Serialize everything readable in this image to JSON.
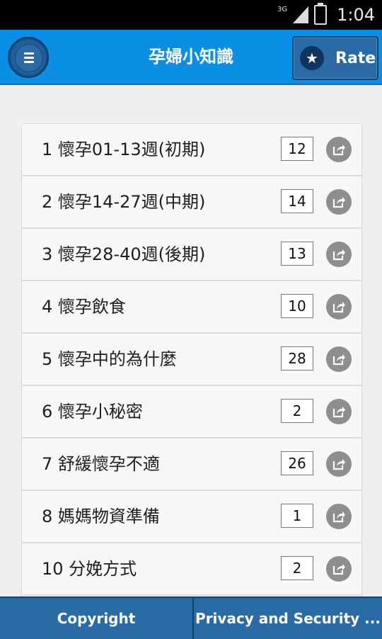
{
  "status_bar": {
    "network": "3G",
    "time": "1:04"
  },
  "app_bar": {
    "menu_icon": "hamburger-menu-icon",
    "title": "孕婦小知識",
    "rate_label": "Rate",
    "rate_icon": "star-icon"
  },
  "list": {
    "items": [
      {
        "label": "1 懷孕01-13週(初期)",
        "count": "12"
      },
      {
        "label": "2 懷孕14-27週(中期)",
        "count": "14"
      },
      {
        "label": "3 懷孕28-40週(後期)",
        "count": "13"
      },
      {
        "label": "4 懷孕飲食",
        "count": "10"
      },
      {
        "label": "5 懷孕中的為什麼",
        "count": "28"
      },
      {
        "label": "6 懷孕小秘密",
        "count": "2"
      },
      {
        "label": "7 舒緩懷孕不適",
        "count": "26"
      },
      {
        "label": "8 媽媽物資準備",
        "count": "1"
      },
      {
        "label": "10 分娩方式",
        "count": "2"
      }
    ],
    "share_icon": "share-icon"
  },
  "footer": {
    "copyright": "Copyright",
    "privacy": "Privacy and Security ..."
  },
  "colors": {
    "app_bar": "#0a8fe4",
    "button_blue": "#2a6ba6",
    "list_bg": "#f7f7f7",
    "page_bg": "#efefef"
  }
}
